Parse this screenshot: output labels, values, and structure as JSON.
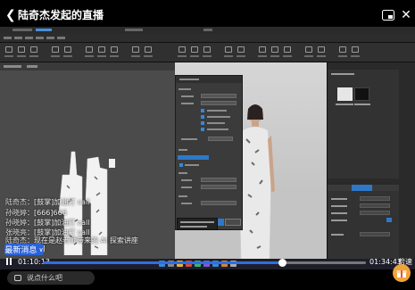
{
  "header": {
    "title": "陆奇杰发起的直播"
  },
  "video": {
    "app_version_hint": ""
  },
  "danmaku": [
    {
      "user": "陆奇杰",
      "message": "[鼓掌]加油打 call"
    },
    {
      "user": "孙晓婷",
      "message": "[666]666"
    },
    {
      "user": "孙晓婷",
      "message": "[鼓掌]加油打 call"
    },
    {
      "user": "张晓亮",
      "message": "[鼓掌]加油打 call"
    },
    {
      "user": "陆奇杰",
      "message": "现在是赵老师带来的 AI 探索讲座[鼓掌][鼓掌]"
    }
  ],
  "news_badge": {
    "label": "最新消息"
  },
  "player": {
    "current_time": "01:10:13",
    "total_time": "01:34:43",
    "progress": 0.741,
    "speed_label": "倍速"
  },
  "comment": {
    "placeholder": "说点什么吧"
  },
  "colors": {
    "accent": "#2f6fe0",
    "badge": "#2b63d9",
    "app_bg": "#4b4b4b"
  }
}
